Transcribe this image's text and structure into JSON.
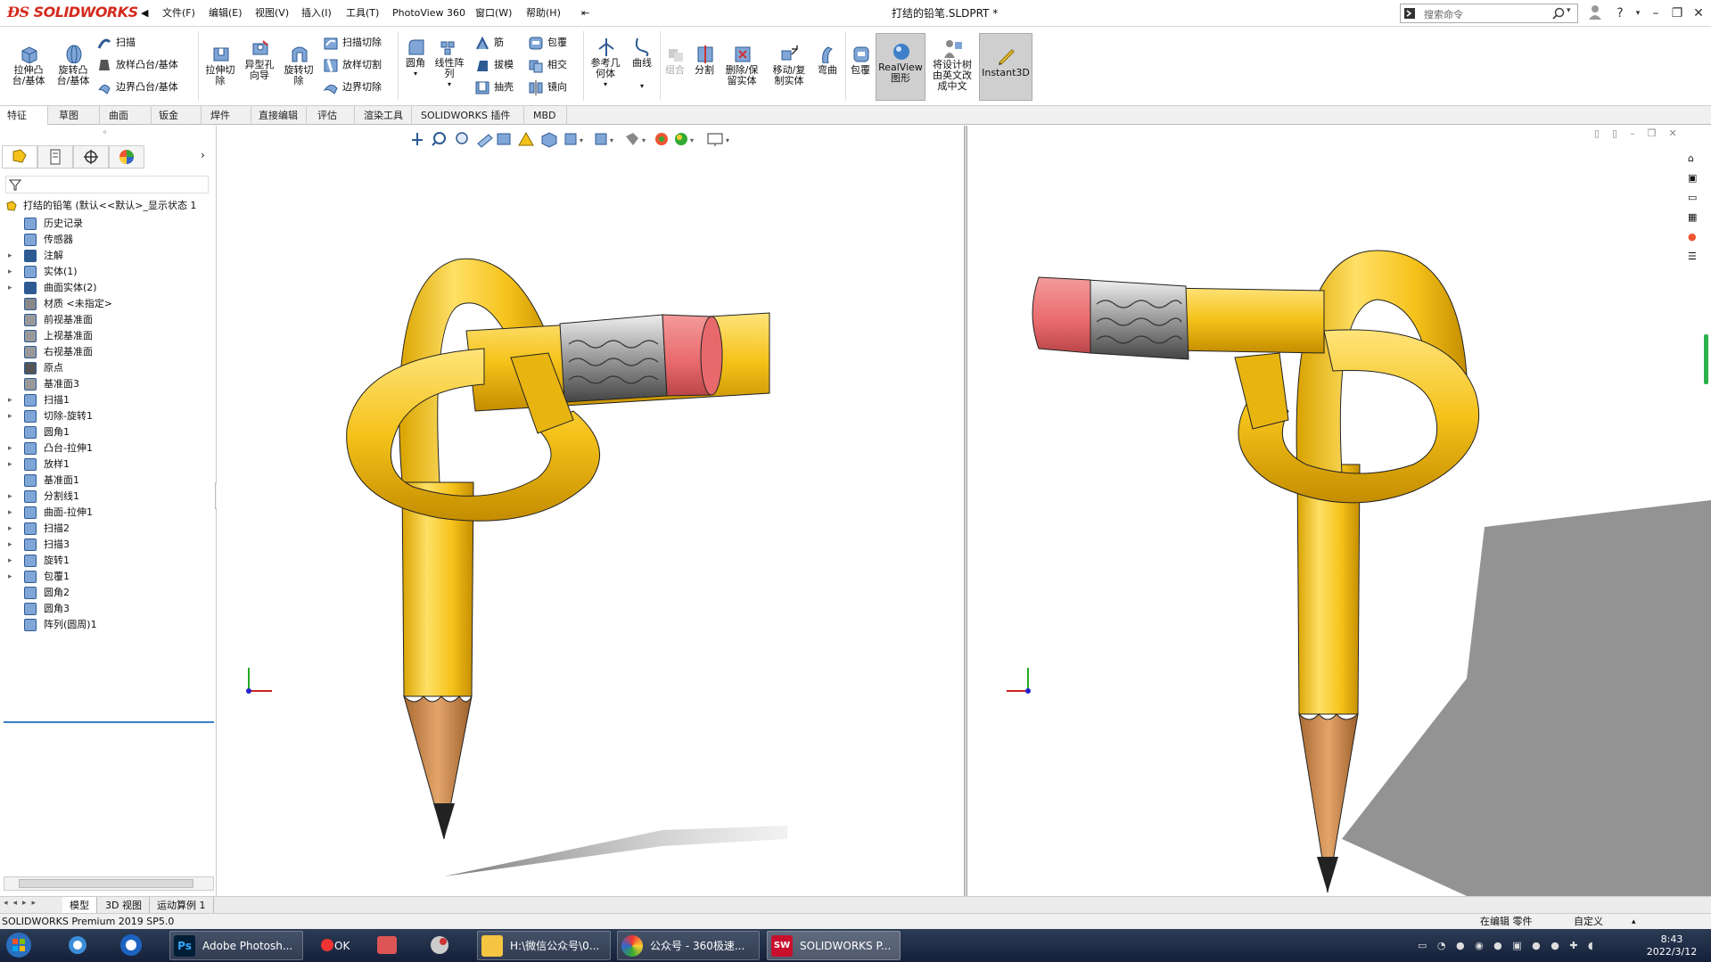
{
  "app": {
    "logo_text": "SOLIDWORKS",
    "doc_title": "打结的铅笔.SLDPRT *"
  },
  "menus": [
    "文件(F)",
    "编辑(E)",
    "视图(V)",
    "插入(I)",
    "工具(T)",
    "PhotoView 360",
    "窗口(W)",
    "帮助(H)"
  ],
  "search": {
    "placeholder": "搜索命令"
  },
  "ribbon": {
    "extrude_boss": "拉伸凸\n台/基体",
    "revolve_boss": "旋转凸\n台/基体",
    "sweep": "扫描",
    "loft_boss": "放样凸台/基体",
    "boundary_boss": "边界凸台/基体",
    "extrude_cut": "拉伸切\n除",
    "hole_wizard": "异型孔\n向导",
    "revolve_cut": "旋转切\n除",
    "swept_cut": "扫描切除",
    "lofted_cut": "放样切割",
    "boundary_cut": "边界切除",
    "fillet": "圆角",
    "linear_pattern": "线性阵\n列",
    "rib": "筋",
    "draft": "拔模",
    "shell": "抽壳",
    "wrap": "包覆",
    "intersect": "相交",
    "mirror": "镜向",
    "ref_geometry": "参考几\n何体",
    "curves": "曲线",
    "combine": "组合",
    "split": "分割",
    "delete_body": "删除/保\n留实体",
    "move_copy": "移动/复\n制实体",
    "flex": "弯曲",
    "wrap2": "包覆",
    "realview": "RealView\n图形",
    "translate": "将设计树\n由英文改\n成中文",
    "instant3d": "Instant3D"
  },
  "tabs": [
    "特征",
    "草图",
    "曲面",
    "钣金",
    "焊件",
    "直接编辑",
    "评估",
    "渲染工具",
    "SOLIDWORKS 插件",
    "MBD"
  ],
  "tree": {
    "root": "打结的铅笔 (默认<<默认>_显示状态 1",
    "items": [
      {
        "label": "历史记录",
        "exp": ""
      },
      {
        "label": "传感器",
        "exp": ""
      },
      {
        "label": "注解",
        "exp": "▸"
      },
      {
        "label": "实体(1)",
        "exp": "▸"
      },
      {
        "label": "曲面实体(2)",
        "exp": "▸"
      },
      {
        "label": "材质 <未指定>",
        "exp": ""
      },
      {
        "label": "前视基准面",
        "exp": ""
      },
      {
        "label": "上视基准面",
        "exp": ""
      },
      {
        "label": "右视基准面",
        "exp": ""
      },
      {
        "label": "原点",
        "exp": ""
      },
      {
        "label": "基准面3",
        "exp": ""
      },
      {
        "label": "扫描1",
        "exp": "▸"
      },
      {
        "label": "切除-旋转1",
        "exp": "▸"
      },
      {
        "label": "圆角1",
        "exp": ""
      },
      {
        "label": "凸台-拉伸1",
        "exp": "▸"
      },
      {
        "label": "放样1",
        "exp": "▸"
      },
      {
        "label": "基准面1",
        "exp": ""
      },
      {
        "label": "分割线1",
        "exp": "▸"
      },
      {
        "label": "曲面-拉伸1",
        "exp": "▸"
      },
      {
        "label": "扫描2",
        "exp": "▸"
      },
      {
        "label": "扫描3",
        "exp": "▸"
      },
      {
        "label": "旋转1",
        "exp": "▸"
      },
      {
        "label": "包覆1",
        "exp": "▸"
      },
      {
        "label": "圆角2",
        "exp": ""
      },
      {
        "label": "圆角3",
        "exp": ""
      },
      {
        "label": "阵列(圆周)1",
        "exp": ""
      }
    ]
  },
  "model_tabs": [
    "模型",
    "3D 视图",
    "运动算例 1"
  ],
  "status": {
    "left": "SOLIDWORKS Premium 2019 SP5.0",
    "mode": "在编辑 零件",
    "custom": "自定义"
  },
  "taskbar": {
    "items": [
      "Adobe Photosh...",
      "H:\\微信公众号\\0...",
      "公众号 - 360极速...",
      "SOLIDWORKS P..."
    ],
    "time": "8:43",
    "date": "2022/3/12"
  },
  "colors": {
    "pencil": "#f5c21a",
    "eraser": "#e8696b",
    "accent": "#d52b1e"
  }
}
